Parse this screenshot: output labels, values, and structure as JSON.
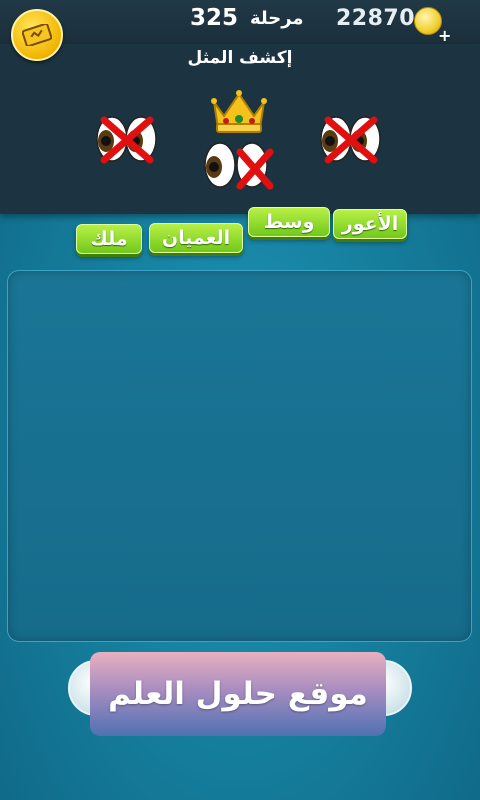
{
  "header": {
    "level_label": "مرحلة",
    "level_number": "325",
    "coins": "228704",
    "coin_icon": "coin-icon",
    "plus_icon": "plus-icon",
    "hint_icon": "hint-ticket-icon"
  },
  "puzzle": {
    "title": "إكشف المثل",
    "clues": [
      "eye-crossed-icon",
      "crown-icon",
      "eye-open-icon",
      "eye-crossed-icon",
      "eye-crossed-icon"
    ]
  },
  "tiles": [
    "الأعور",
    "وسط",
    "العميان",
    "ملك"
  ],
  "watermark": "موقع حلول العلم",
  "colors": {
    "tile_green": "#8ad82a",
    "panel_dark": "#1c3442",
    "background": "#1783a6"
  }
}
